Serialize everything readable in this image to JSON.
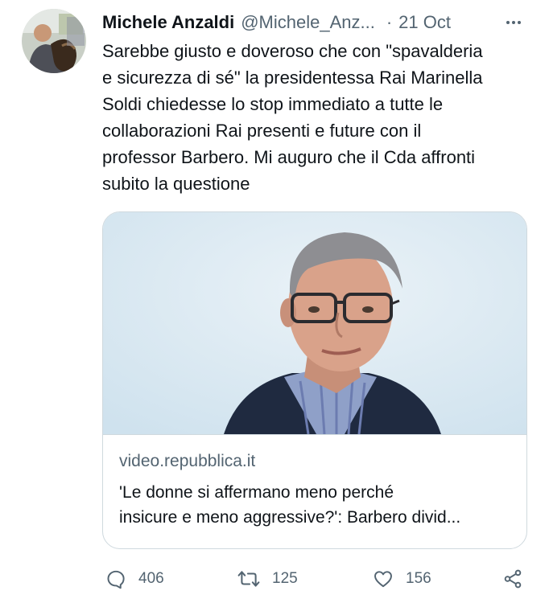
{
  "author": {
    "name": "Michele Anzaldi",
    "handle": "@Michele_Anz...",
    "separator": "·",
    "date": "21 Oct"
  },
  "tweet": {
    "text": "Sarebbe giusto e doveroso che con \"spavalderia\ne sicurezza di sé\" la presidentessa Rai Marinella\nSoldi chiedesse lo stop immediato a tutte le\ncollaborazioni Rai presenti e future con il\nprofessor Barbero. Mi auguro che il Cda affronti\nsubito la questione"
  },
  "link_card": {
    "domain": "video.repubblica.it",
    "title": "'Le donne si affermano meno perché\ninsicure e meno aggressive?': Barbero divid..."
  },
  "actions": {
    "reply_count": "406",
    "retweet_count": "125",
    "like_count": "156"
  },
  "icons": {
    "more": "more-icon",
    "reply": "reply-icon",
    "retweet": "retweet-icon",
    "like": "like-icon",
    "share": "share-icon"
  },
  "colors": {
    "text_primary": "#0f1419",
    "text_secondary": "#536471",
    "border": "#cfd9de"
  }
}
